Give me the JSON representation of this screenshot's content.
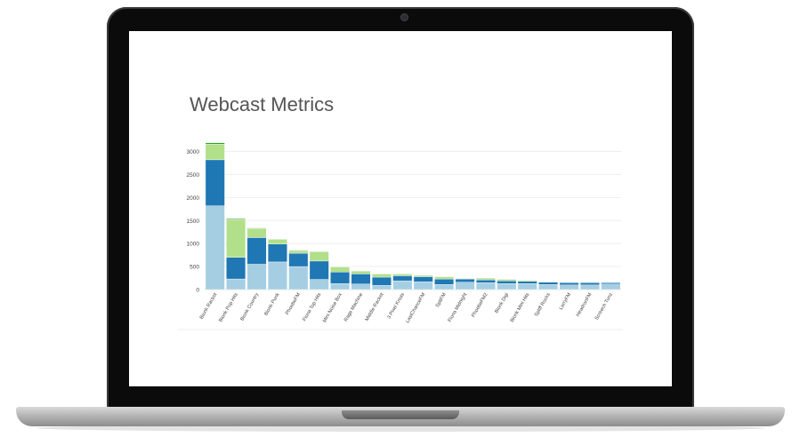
{
  "chart_data": {
    "type": "bar",
    "stacked": true,
    "title": "Webcast Metrics",
    "xlabel": "",
    "ylabel": "",
    "ylim": [
      0,
      3300
    ],
    "yticks": [
      0,
      500,
      1000,
      1500,
      2000,
      2500,
      3000
    ],
    "grid": true,
    "legend": "none",
    "categories": [
      "Bionk Racket",
      "Bionk Pop Hits",
      "Bionk Country",
      "Bionk Punk",
      "PhoebeFM",
      "Fiona Top Hits",
      "Mini Noise Box",
      "Rage Machine",
      "Middle Racket",
      "3 Pixel Knots",
      "LastChanceFM",
      "SpitFM",
      "Fiona Midnight",
      "PhoebeFM2",
      "Bionk Digi",
      "Bionk Mini Hits",
      "Spliff Rocks",
      "LarryFM",
      "HeadronFM",
      "Screech Tunz"
    ],
    "series": [
      {
        "values": [
          1820,
          230,
          550,
          600,
          500,
          220,
          130,
          120,
          90,
          190,
          170,
          110,
          160,
          150,
          130,
          130,
          110,
          100,
          100,
          120
        ],
        "color": "#a6cee3"
      },
      {
        "values": [
          1000,
          470,
          580,
          390,
          290,
          400,
          250,
          220,
          180,
          110,
          110,
          120,
          70,
          60,
          60,
          50,
          50,
          50,
          50,
          30
        ],
        "color": "#1f78b4"
      },
      {
        "values": [
          340,
          820,
          200,
          100,
          60,
          200,
          110,
          60,
          70,
          40,
          30,
          50,
          10,
          40,
          30,
          20,
          10,
          10,
          10,
          0
        ],
        "color": "#b2df8a"
      },
      {
        "values": [
          30,
          20,
          10,
          10,
          10,
          10,
          5,
          5,
          5,
          5,
          5,
          5,
          5,
          5,
          5,
          5,
          5,
          5,
          5,
          0
        ],
        "color": "#33a02c"
      }
    ]
  }
}
